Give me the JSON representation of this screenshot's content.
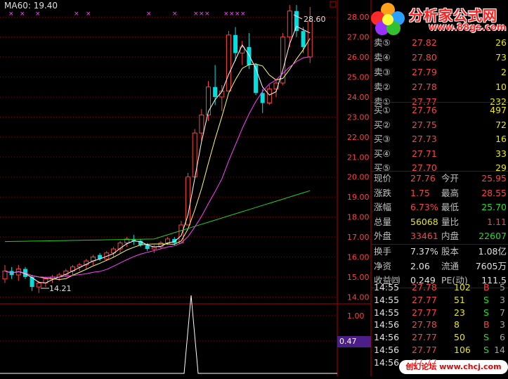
{
  "indicator": {
    "ma60_label": "MA60: 19.40"
  },
  "annotations": {
    "high_marker": "28.60",
    "low_marker": "14.21"
  },
  "price_axis": [
    "28.00",
    "27.00",
    "26.00",
    "25.00",
    "24.00",
    "23.00",
    "22.00",
    "21.00",
    "20.00",
    "19.00",
    "18.00",
    "17.00",
    "16.00",
    "15.00",
    "14.00"
  ],
  "volume_axis": [
    "1.00",
    "0.50"
  ],
  "volume_current": "0.47",
  "order_book": {
    "sell": [
      {
        "label": "卖⑤",
        "price": "27.82",
        "vol": "26"
      },
      {
        "label": "卖④",
        "price": "27.80",
        "vol": "73"
      },
      {
        "label": "卖③",
        "price": "27.79",
        "vol": "2"
      },
      {
        "label": "卖②",
        "price": "27.78",
        "vol": "10"
      },
      {
        "label": "卖①",
        "price": "27.77",
        "vol": "232"
      }
    ],
    "buy": [
      {
        "label": "买①",
        "price": "27.76",
        "vol": "497"
      },
      {
        "label": "买②",
        "price": "27.75",
        "vol": "72"
      },
      {
        "label": "买③",
        "price": "27.73",
        "vol": "16"
      },
      {
        "label": "买④",
        "price": "27.71",
        "vol": "33"
      },
      {
        "label": "买⑤",
        "price": "27.70",
        "vol": "29"
      }
    ]
  },
  "quote": {
    "rows": [
      {
        "l1": "现价",
        "v1": "27.76",
        "l2": "今开",
        "v2": "25.95"
      },
      {
        "l1": "涨跌",
        "v1": "1.75",
        "l2": "最高",
        "v2": "28.55"
      },
      {
        "l1": "涨幅",
        "v1": "6.73%",
        "l2": "最低",
        "v2": "25.70"
      },
      {
        "l1": "总量",
        "v1": "56068",
        "l2": "量比",
        "v2": "1.11"
      },
      {
        "l1": "外盘",
        "v1": "33461",
        "l2": "内盘",
        "v2": "22607"
      }
    ],
    "rows2": [
      {
        "l1": "换手",
        "v1": "7.37%",
        "l2": "股本",
        "v2": "1.08亿"
      },
      {
        "l1": "净资",
        "v1": "2.06",
        "l2": "流通",
        "v2": "7605万"
      },
      {
        "l1": "收益㈣",
        "v1": "0.249",
        "l2": "PE(动)",
        "v2": "111.5"
      }
    ]
  },
  "ticks": [
    {
      "time": "14:55",
      "price": "27.78",
      "vol": "102",
      "side": "B",
      "n": "5"
    },
    {
      "time": "14:55",
      "price": "27.77",
      "vol": "51",
      "side": "S",
      "n": "3"
    },
    {
      "time": "14:55",
      "price": "27.77",
      "vol": "23",
      "side": "S",
      "n": "7"
    },
    {
      "time": "14:56",
      "price": "27.78",
      "vol": "8",
      "side": "B",
      "n": "3"
    },
    {
      "time": "14:56",
      "price": "27.77",
      "vol": "50",
      "side": "S",
      "n": "6"
    },
    {
      "time": "14:56",
      "price": "27.77",
      "vol": "106",
      "side": "S",
      "n": "14"
    },
    {
      "time": "14:56",
      "price": "27.77",
      "vol": "",
      "side": "",
      "n": ""
    }
  ],
  "logo": {
    "title": "分析家公式网",
    "url": "www.88gs.com"
  },
  "watermark": "创幻论坛 www.chcj.com",
  "colors": {
    "up": "#ff4040",
    "down": "#00e0e0",
    "ma5": "#ffffff",
    "ma10": "#ffff60",
    "ma20": "#ff40ff",
    "ma60": "#20d020",
    "grid": "#800000"
  },
  "chart_data": {
    "type": "candlestick",
    "ylim": [
      13.8,
      28.5
    ],
    "candles": [
      [
        14.9,
        15.6,
        14.7,
        15.3
      ],
      [
        15.3,
        15.5,
        14.9,
        15.1
      ],
      [
        15.1,
        15.6,
        14.8,
        15.4
      ],
      [
        15.4,
        15.5,
        14.9,
        15.0
      ],
      [
        15.0,
        15.1,
        14.3,
        14.5
      ],
      [
        14.5,
        14.8,
        14.2,
        14.7
      ],
      [
        14.7,
        15.0,
        14.5,
        14.9
      ],
      [
        14.9,
        15.1,
        14.7,
        15.0
      ],
      [
        15.0,
        15.2,
        14.8,
        15.1
      ],
      [
        15.1,
        15.4,
        15.0,
        15.3
      ],
      [
        15.3,
        15.6,
        15.1,
        15.5
      ],
      [
        15.5,
        15.7,
        15.3,
        15.6
      ],
      [
        15.6,
        15.9,
        15.4,
        15.8
      ],
      [
        15.8,
        16.1,
        15.6,
        16.0
      ],
      [
        16.1,
        16.2,
        15.8,
        15.9
      ],
      [
        15.9,
        16.3,
        15.8,
        16.2
      ],
      [
        16.2,
        16.5,
        16.0,
        16.4
      ],
      [
        16.4,
        16.8,
        16.2,
        16.7
      ],
      [
        16.7,
        17.0,
        16.5,
        16.9
      ],
      [
        16.9,
        17.1,
        16.6,
        16.8
      ],
      [
        16.8,
        16.9,
        16.5,
        16.6
      ],
      [
        16.6,
        16.7,
        16.3,
        16.4
      ],
      [
        16.4,
        16.6,
        16.2,
        16.5
      ],
      [
        16.5,
        16.8,
        16.4,
        16.7
      ],
      [
        16.7,
        17.0,
        16.6,
        16.9
      ],
      [
        16.9,
        17.0,
        16.6,
        16.7
      ],
      [
        16.7,
        17.8,
        16.7,
        17.6
      ],
      [
        17.6,
        20.2,
        17.6,
        20.0
      ],
      [
        20.0,
        22.4,
        20.0,
        22.2
      ],
      [
        22.2,
        23.4,
        21.8,
        23.1
      ],
      [
        23.1,
        24.8,
        22.8,
        24.5
      ],
      [
        24.5,
        25.6,
        23.6,
        24.0
      ],
      [
        24.0,
        24.6,
        23.3,
        24.3
      ],
      [
        24.3,
        27.3,
        24.3,
        27.1
      ],
      [
        27.1,
        27.5,
        25.8,
        26.2
      ],
      [
        26.2,
        26.8,
        25.6,
        26.5
      ],
      [
        26.5,
        27.2,
        25.4,
        25.6
      ],
      [
        25.6,
        25.7,
        24.1,
        24.2
      ],
      [
        24.2,
        24.4,
        23.2,
        23.7
      ],
      [
        23.7,
        24.6,
        23.6,
        24.4
      ],
      [
        24.4,
        24.9,
        24.0,
        24.7
      ],
      [
        24.7,
        27.2,
        24.6,
        27.0
      ],
      [
        27.0,
        28.6,
        26.5,
        28.3
      ],
      [
        28.3,
        28.6,
        27.0,
        27.3
      ],
      [
        27.3,
        27.5,
        26.2,
        26.5
      ],
      [
        26.0,
        28.5,
        25.7,
        27.8
      ]
    ]
  }
}
